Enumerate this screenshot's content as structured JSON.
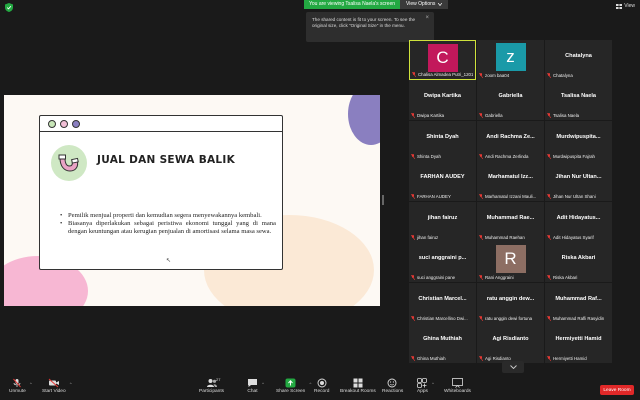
{
  "topbar": {
    "viewing_text": "You are viewing Tsalisa Naela's screen",
    "view_options_label": "View Options",
    "view_label": "View"
  },
  "tooltip": {
    "text": "The shared content is fit to your screen. To see the original size, click \"Original Size\" in the menu."
  },
  "slide": {
    "title": "JUAL DAN SEWA BALIK",
    "bullets": [
      "Pemilik menjual properti dan kemudian segera menyewakannya kembali.",
      "Biasanya diperlakukan sebagai peristiwa ekonomi tunggal yang di mana dengan keuntungan atau kerugian penjualan di amortisasi selama masa sewa."
    ],
    "dot_colors": [
      "#c8e6b8",
      "#f1bfd6",
      "#8a7fc0"
    ]
  },
  "participants": [
    {
      "name": "",
      "label": "Chalisa Almadea Putri_1201...",
      "avatar": "C",
      "avatar_color": "#c2185b",
      "active": true
    },
    {
      "name": "",
      "label": "zoom baa04",
      "avatar": "z",
      "avatar_color": "#1a9aa8"
    },
    {
      "name": "Chatalyna",
      "label": "Chatalyna"
    },
    {
      "name": "Dwipa Kartika",
      "label": "Dwipa Kartika"
    },
    {
      "name": "Gabriella",
      "label": "Gabriella"
    },
    {
      "name": "Tsalisa Naela",
      "label": "Tsalisa Naela"
    },
    {
      "name": "Shinta Dyah",
      "label": "Shinta Dyah"
    },
    {
      "name": "Andi Rachma Ze...",
      "label": "Andi Rachma Zerlinda"
    },
    {
      "name": "Murdwipuspita...",
      "label": "Murdwipuspita Fajrah"
    },
    {
      "name": "FARHAN AUDEY",
      "label": "FARHAN AUDEY"
    },
    {
      "name": "Marhamatul Izz...",
      "label": "Marhamatul Izzani Mauli..."
    },
    {
      "name": "Jihan Nur Ultan...",
      "label": "Jihan Nur Ultan Shani"
    },
    {
      "name": "jihan fairuz",
      "label": "jihan fairuz"
    },
    {
      "name": "Muhammad Rae...",
      "label": "Muhammad Raehan"
    },
    {
      "name": "Adit Hidayatus...",
      "label": "Adit Hidayatus Syarif"
    },
    {
      "name": "suci anggraini p...",
      "label": "suci anggraini pane"
    },
    {
      "name": "",
      "label": "Rani Anggraini",
      "avatar": "R",
      "avatar_color": "#8d6e63"
    },
    {
      "name": "Riska Akbari",
      "label": "Riska Akbari"
    },
    {
      "name": "Christian Marcel...",
      "label": "Christian Marcellino Dwi..."
    },
    {
      "name": "ratu anggin dew...",
      "label": "ratu anggin dewi fortuna"
    },
    {
      "name": "Muhammad Raf...",
      "label": "Muhammad Rafli Rasyidin"
    },
    {
      "name": "Ghina Muthiah",
      "label": "Ghina Muthiah"
    },
    {
      "name": "Agi Risdianto",
      "label": "Agi Risdianto"
    },
    {
      "name": "Hermiyetti Hamid",
      "label": "Hermiyetti Hamid"
    }
  ],
  "toolbar": {
    "unmute": "Unmute",
    "start_video": "Start Video",
    "participants": "Participants",
    "participants_count": "27",
    "chat": "Chat",
    "share_screen": "Share Screen",
    "record": "Record",
    "breakout": "Breakout Rooms",
    "reactions": "Reactions",
    "apps": "Apps",
    "whiteboards": "Whiteboards",
    "leave": "Leave Room"
  },
  "colors": {
    "share_green": "#23a942",
    "leave_red": "#e02828",
    "active_border": "#cfe23c",
    "mic_red": "#e53935"
  }
}
